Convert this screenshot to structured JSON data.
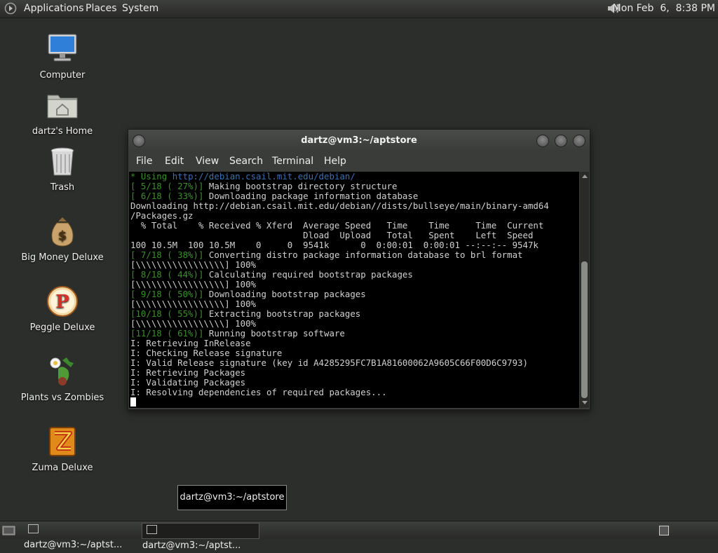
{
  "top_panel": {
    "menus": [
      "Applications",
      "Places",
      "System"
    ],
    "clock": "Mon Feb  6,  8:38 PM"
  },
  "desktop_icons": [
    {
      "label": "Computer",
      "icon": "computer-icon"
    },
    {
      "label": "dartz's Home",
      "icon": "home-folder-icon"
    },
    {
      "label": "Trash",
      "icon": "trash-icon"
    },
    {
      "label": "Big Money Deluxe",
      "icon": "money-bag-icon"
    },
    {
      "label": "Peggle Deluxe",
      "icon": "peggle-icon"
    },
    {
      "label": "Plants vs Zombies",
      "icon": "plants-vs-zombies-icon"
    },
    {
      "label": "Zuma Deluxe",
      "icon": "zuma-icon"
    }
  ],
  "terminal": {
    "title": "dartz@vm3:~/aptstore",
    "menu": [
      "File",
      "Edit",
      "View",
      "Search",
      "Terminal",
      "Help"
    ],
    "lines": [
      {
        "prefix": "* Using ",
        "prefix_color": "green",
        "text": "http://debian.csail.mit.edu/debian/",
        "text_color": "blue"
      },
      {
        "prefix": "[ 5/18 ( 27%)] ",
        "prefix_color": "green",
        "text": "Making bootstrap directory structure"
      },
      {
        "prefix": "[ 6/18 ( 33%)] ",
        "prefix_color": "green",
        "text": "Downloading package information database"
      },
      {
        "text": "Downloading http://debian.csail.mit.edu/debian//dists/bullseye/main/binary-amd64"
      },
      {
        "text": "/Packages.gz"
      },
      {
        "text": "  % Total    % Received % Xferd  Average Speed   Time    Time     Time  Current"
      },
      {
        "text": "                                 Dload  Upload   Total   Spent    Left  Speed"
      },
      {
        "text": "100 10.5M  100 10.5M    0     0  9541k      0  0:00:01  0:00:01 --:--:-- 9547k"
      },
      {
        "prefix": "[ 7/18 ( 38%)] ",
        "prefix_color": "green",
        "text": "Converting distro package information database to brl format"
      },
      {
        "text": "[\\\\\\\\\\\\\\\\\\\\\\\\\\\\\\\\\\] 100%"
      },
      {
        "prefix": "[ 8/18 ( 44%)] ",
        "prefix_color": "green",
        "text": "Calculating required bootstrap packages"
      },
      {
        "text": "[\\\\\\\\\\\\\\\\\\\\\\\\\\\\\\\\\\] 100%"
      },
      {
        "prefix": "[ 9/18 ( 50%)] ",
        "prefix_color": "green",
        "text": "Downloading bootstrap packages"
      },
      {
        "text": "[\\\\\\\\\\\\\\\\\\\\\\\\\\\\\\\\\\] 100%"
      },
      {
        "prefix": "[10/18 ( 55%)] ",
        "prefix_color": "green",
        "text": "Extracting bootstrap packages"
      },
      {
        "text": "[\\\\\\\\\\\\\\\\\\\\\\\\\\\\\\\\\\] 100%"
      },
      {
        "prefix": "[11/18 ( 61%)] ",
        "prefix_color": "green",
        "text": "Running bootstrap software"
      },
      {
        "text": "I: Retrieving InRelease"
      },
      {
        "text": "I: Checking Release signature"
      },
      {
        "text": "I: Valid Release signature (key id A4285295FC7B1A81600062A9605C66F00D6C9793)"
      },
      {
        "text": "I: Retrieving Packages"
      },
      {
        "text": "I: Validating Packages"
      },
      {
        "text": "I: Resolving dependencies of required packages..."
      }
    ]
  },
  "tooltip": "dartz@vm3:~/aptstore",
  "taskbar": {
    "tasks": [
      "dartz@vm3:~/aptst...",
      "dartz@vm3:~/aptst..."
    ]
  },
  "colors": {
    "prompt_green": "#3a8f2a",
    "url_blue": "#3b6fb0",
    "desktop_bg": "#2c2e2b"
  }
}
